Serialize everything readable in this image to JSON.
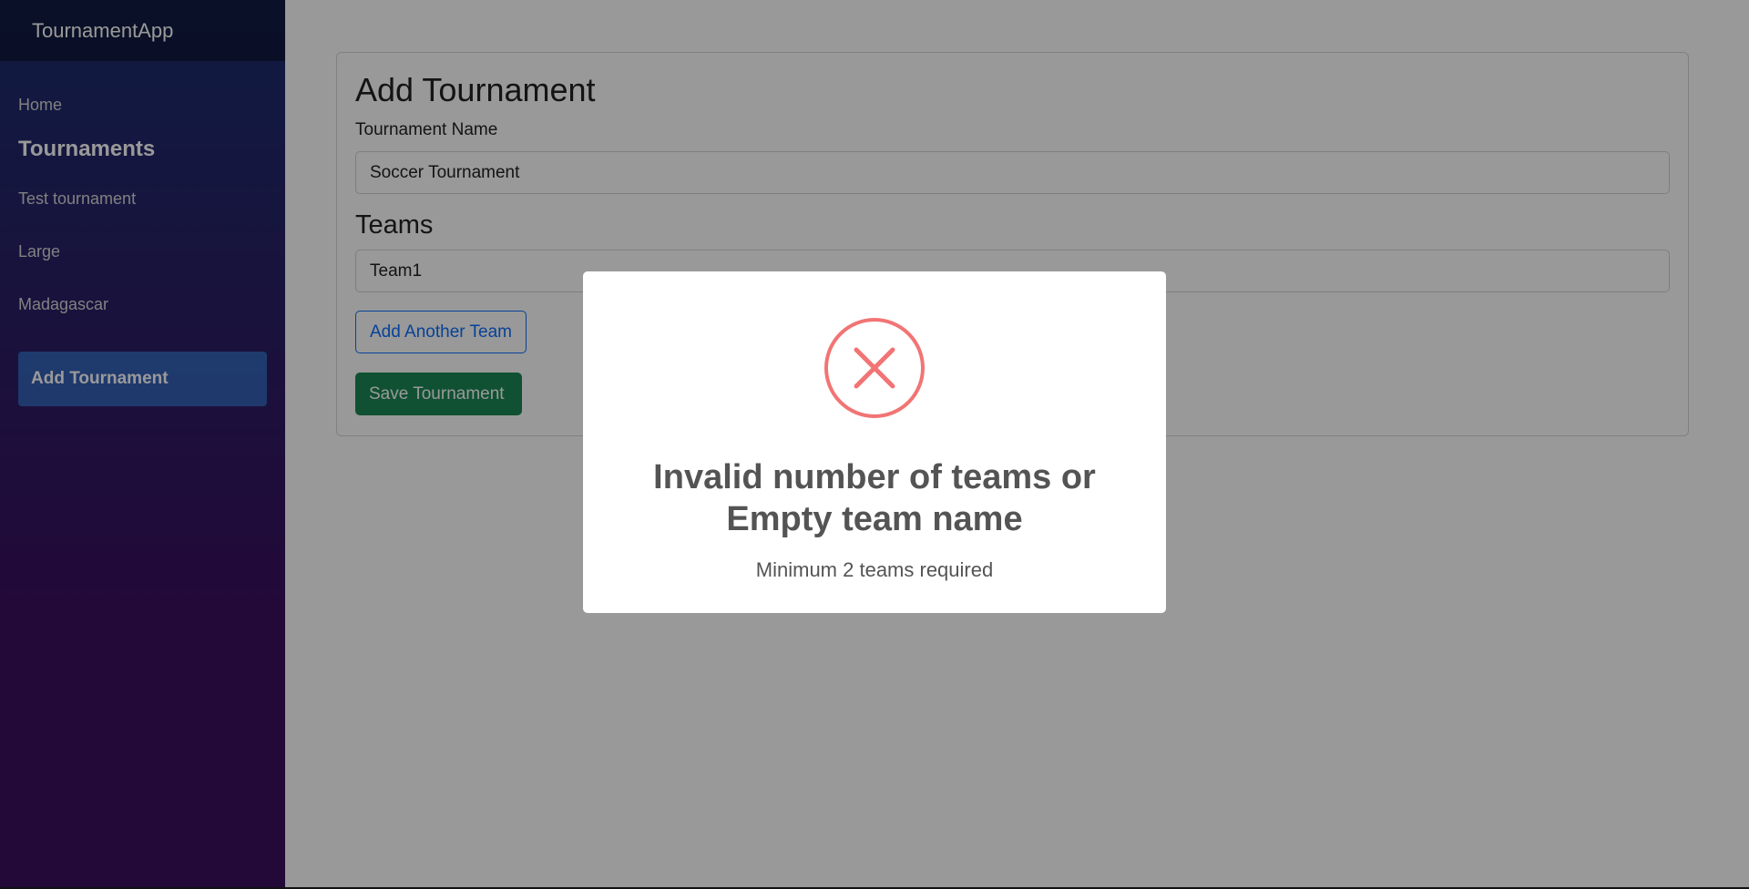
{
  "sidebar": {
    "brand": "TournamentApp",
    "home": "Home",
    "heading": "Tournaments",
    "tournaments": [
      "Test tournament",
      "Large",
      "Madagascar"
    ],
    "add_tournament": "Add Tournament"
  },
  "form": {
    "title": "Add Tournament",
    "name_label": "Tournament Name",
    "name_value": "Soccer Tournament",
    "teams_heading": "Teams",
    "team_value": "Team1",
    "add_team_label": "Add Another Team",
    "save_label": "Save Tournament"
  },
  "modal": {
    "icon": "error-x-icon",
    "title_line1": "Invalid number of teams or",
    "title_line2": "Empty team name",
    "text": "Minimum 2 teams required"
  },
  "colors": {
    "primary": "#0d6efd",
    "success": "#198754",
    "error": "#f27474",
    "sidebar_top": "#1b2e6e",
    "sidebar_bottom": "#3a0f5e"
  }
}
